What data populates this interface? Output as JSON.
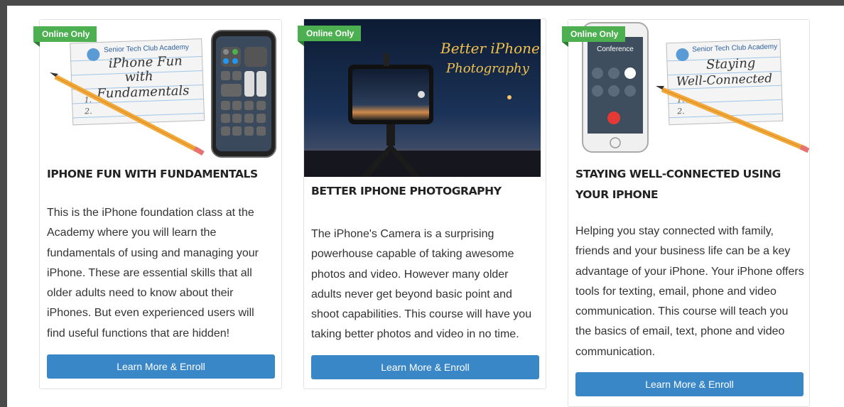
{
  "cards": [
    {
      "badge": "Online Only",
      "title": "IPHONE FUN WITH FUNDAMENTALS",
      "image_text": {
        "academy": "Senior Tech Club Academy",
        "line1": "iPhone Fun",
        "line2": "with",
        "line3": "Fundamentals",
        "list1": "1.",
        "list2": "2."
      },
      "description": "This is the iPhone foundation class at the Academy where you will learn the fundamentals of using and managing your iPhone.  These are essential skills that all older adults need to know about their iPhones. But even experienced users will find useful functions that are hidden!",
      "button": "Learn More & Enroll"
    },
    {
      "badge": "Online Only",
      "title": "BETTER IPHONE PHOTOGRAPHY",
      "image_text": {
        "line1": "Better iPhone",
        "line2": "Photography"
      },
      "description": "The iPhone's Camera is a surprising powerhouse capable of taking awesome photos and video.  However many older adults never get beyond basic point and shoot capabilities. This course will have you taking better photos and video in no time.",
      "button": "Learn More & Enroll"
    },
    {
      "badge": "Online Only",
      "title": "STAYING WELL-CONNECTED USING YOUR IPHONE",
      "image_text": {
        "academy": "Senior Tech Club Academy",
        "line1": "Staying",
        "line2": "Well-Connected",
        "list1": "1.",
        "list2": "2.",
        "call_label": "Conference"
      },
      "description": "Helping you stay connected with family, friends and your business life can be a key advantage of your iPhone.  Your iPhone offers tools for texting, email, phone and video communication.  This course will teach you the basics of email, text, phone and video communication.",
      "button": "Learn More & Enroll"
    }
  ],
  "colors": {
    "badge": "#4caf50",
    "button": "#3a87c8",
    "title": "#222222",
    "text": "#333333"
  }
}
